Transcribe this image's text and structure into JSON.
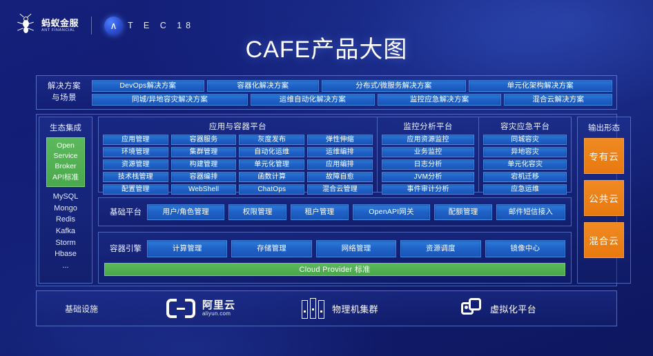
{
  "brand": {
    "ant_cn": "蚂蚁金服",
    "ant_en": "ANT FINANCIAL",
    "atec_glyph": "∧",
    "atec_text": "T E C  18"
  },
  "title": "CAFE产品大图",
  "solutions": {
    "label": "解决方案\n与场景",
    "label_line1": "解决方案",
    "label_line2": "与场景",
    "row1": [
      "DevOps解决方案",
      "容器化解决方案",
      "分布式/微服务解决方案",
      "单元化架构解决方案"
    ],
    "row2": [
      "同城/异地容灾解决方案",
      "运维自动化解决方案",
      "监控应急解决方案",
      "混合云解决方案"
    ]
  },
  "ecosystem": {
    "title": "生态集成",
    "osb_lines": [
      "Open",
      "Service",
      "Broker",
      "API标准"
    ],
    "osb_color": "#5cb85c",
    "items": [
      "MySQL",
      "Mongo",
      "Redis",
      "Kafka",
      "Storm",
      "Hbase",
      "..."
    ]
  },
  "platforms": [
    {
      "id": "app-container-platform",
      "title": "应用与容器平台",
      "columns": [
        [
          "应用管理",
          "环境管理",
          "资源管理",
          "技术栈管理",
          "配置管理"
        ],
        [
          "容器服务",
          "集群管理",
          "构建管理",
          "容器编排",
          "WebShell"
        ],
        [
          "灰度发布",
          "自动化运维",
          "单元化管理",
          "函数计算",
          "ChatOps"
        ],
        [
          "弹性伸缩",
          "运维编排",
          "应用编排",
          "故障自愈",
          "混合云管理"
        ]
      ]
    },
    {
      "id": "monitor-analysis-platform",
      "title": "监控分析平台",
      "columns": [
        [
          "应用资源监控",
          "业务监控",
          "日志分析",
          "JVM分析",
          "事件审计分析"
        ]
      ]
    },
    {
      "id": "disaster-recovery-platform",
      "title": "容灾应急平台",
      "columns": [
        [
          "同城容灾",
          "异地容灾",
          "单元化容灾",
          "宕机迁移",
          "应急运维"
        ]
      ]
    }
  ],
  "base_platform": {
    "label": "基础平台",
    "items": [
      "用户/角色管理",
      "权限管理",
      "租户管理",
      "OpenAPI网关",
      "配额管理",
      "邮件短信接入"
    ]
  },
  "container_engine": {
    "label": "容器引擎",
    "items": [
      "计算管理",
      "存储管理",
      "网络管理",
      "资源调度",
      "镜像中心"
    ],
    "cloud_provider_bar": "Cloud Provider 标准"
  },
  "output": {
    "title": "输出形态",
    "items": [
      "专有云",
      "公共云",
      "混合云"
    ],
    "color": "#ee8119"
  },
  "infrastructure": {
    "label": "基础设施",
    "items": [
      {
        "icon": "aliyun-logo-icon",
        "label_cn": "阿里云",
        "label_en": "aliyun.com"
      },
      {
        "icon": "server-rack-icon",
        "label": "物理机集群"
      },
      {
        "icon": "vmware-icon",
        "label": "虚拟化平台"
      }
    ]
  },
  "colors": {
    "background": "#121c74",
    "button_blue": "#1f62c8",
    "green": "#5cb85c",
    "orange": "#ee8119",
    "border": "#87aaff"
  }
}
